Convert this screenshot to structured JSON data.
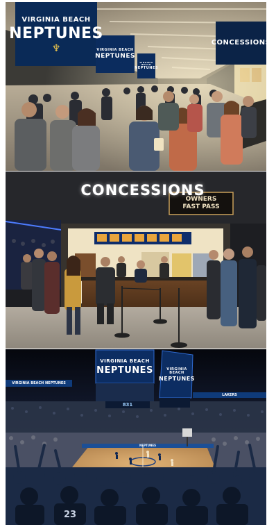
{
  "panel1": {
    "sign_main": {
      "line1": "VIRGINIA BEACH",
      "line2": "NEPTUNES"
    },
    "sign_second": {
      "line1": "VIRGINIA BEACH",
      "line2": "NEPTUNES"
    },
    "sign_third": {
      "line1": "VIRGINIA BEACH",
      "line2": "NEPTUNES"
    },
    "concessions_sign": "CONCESSIONS"
  },
  "panel2": {
    "title": "CONCESSIONS",
    "fast_pass": {
      "line1": "OWNERS",
      "line2": "FAST PASS"
    }
  },
  "panel3": {
    "jumbotron_left": {
      "line1": "VIRGINIA BEACH",
      "line2": "NEPTUNES"
    },
    "jumbotron_right": {
      "line1": "VIRGINIA BEACH",
      "line2": "NEPTUNES"
    },
    "ribbon_left": "VIRGINIA BEACH NEPTUNES",
    "ribbon_right": "LAKERS",
    "score": "831",
    "jersey_number": "23",
    "court_text": "NEPTUNES"
  },
  "colors": {
    "neptunes_navy": "#0b2a55",
    "neptunes_blue": "#1c4f96",
    "court_wood": "#c89a5c",
    "concourse_ceiling": "#b5ab9a"
  }
}
